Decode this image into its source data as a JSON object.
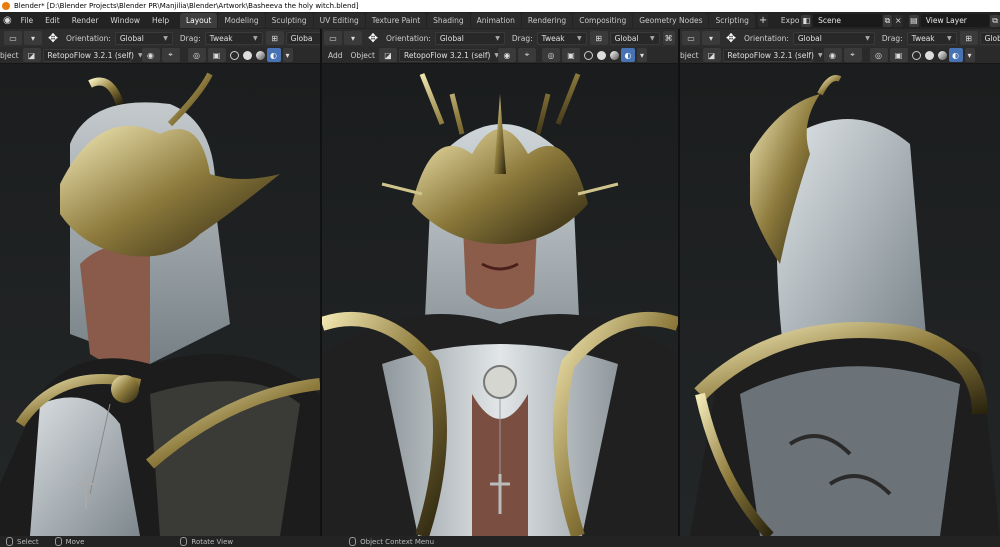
{
  "window": {
    "title": "Blender* [D:\\Blender Projects\\Blender PR\\Manjilia\\Blender\\Artwork\\Basheeva the holy witch.blend]"
  },
  "menu": [
    "File",
    "Edit",
    "Render",
    "Window",
    "Help"
  ],
  "workspaces": [
    {
      "label": "Layout",
      "active": true
    },
    {
      "label": "Modeling",
      "active": false
    },
    {
      "label": "Sculpting",
      "active": false
    },
    {
      "label": "UV Editing",
      "active": false
    },
    {
      "label": "Texture Paint",
      "active": false
    },
    {
      "label": "Shading",
      "active": false
    },
    {
      "label": "Animation",
      "active": false
    },
    {
      "label": "Rendering",
      "active": false
    },
    {
      "label": "Compositing",
      "active": false
    },
    {
      "label": "Geometry Nodes",
      "active": false
    },
    {
      "label": "Scripting",
      "active": false
    }
  ],
  "topright": {
    "expo": "Expo",
    "scene": "Scene",
    "view_layer": "View Layer"
  },
  "header": {
    "orientation_label": "Orientation:",
    "orientation_value": "Global",
    "drag_label": "Drag:",
    "drag_value": "Tweak",
    "global_short": "Globa",
    "global": "Global",
    "object": "Object",
    "object_short": "bject",
    "add": "Add",
    "addon": "RetopoFlow 3.2.1 (self)"
  },
  "status": {
    "select": "Select",
    "move": "Move",
    "rotate": "Rotate View",
    "context": "Object Context Menu"
  },
  "colors": {
    "accent": "#4772b3",
    "active_tab": "#3d3d3d",
    "background": "#1d1d1d"
  },
  "icons": [
    "blender-logo-icon",
    "move-tool-icon",
    "shading-solid-icon",
    "overlay-icon",
    "chevron-down-icon",
    "mouse-icon"
  ]
}
